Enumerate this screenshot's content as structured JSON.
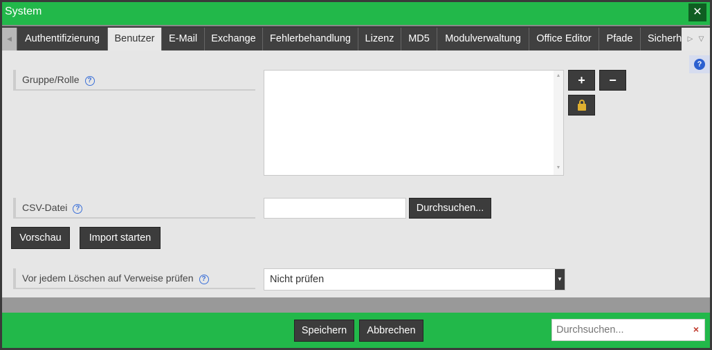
{
  "window": {
    "title": "System",
    "close_icon": "close-icon"
  },
  "tabs": [
    {
      "label": "Authentifizierung"
    },
    {
      "label": "Benutzer",
      "active": true
    },
    {
      "label": "E-Mail"
    },
    {
      "label": "Exchange"
    },
    {
      "label": "Fehlerbehandlung"
    },
    {
      "label": "Lizenz"
    },
    {
      "label": "MD5"
    },
    {
      "label": "Modulverwaltung"
    },
    {
      "label": "Office Editor"
    },
    {
      "label": "Pfade"
    },
    {
      "label": "Sicherh"
    }
  ],
  "form": {
    "group_label": "Gruppe/Rolle",
    "add": "+",
    "remove": "−",
    "csv_label": "CSV-Datei",
    "browse": "Durchsuchen...",
    "preview": "Vorschau",
    "import": "Import starten",
    "check_label": "Vor jedem Löschen auf Verweise prüfen",
    "check_value": "Nicht prüfen",
    "help": "?"
  },
  "footer": {
    "save": "Speichern",
    "cancel": "Abbrechen",
    "search_placeholder": "Durchsuchen...",
    "clear": "×"
  },
  "colors": {
    "accent": "#22b84a",
    "dark": "#3c3c3c"
  }
}
